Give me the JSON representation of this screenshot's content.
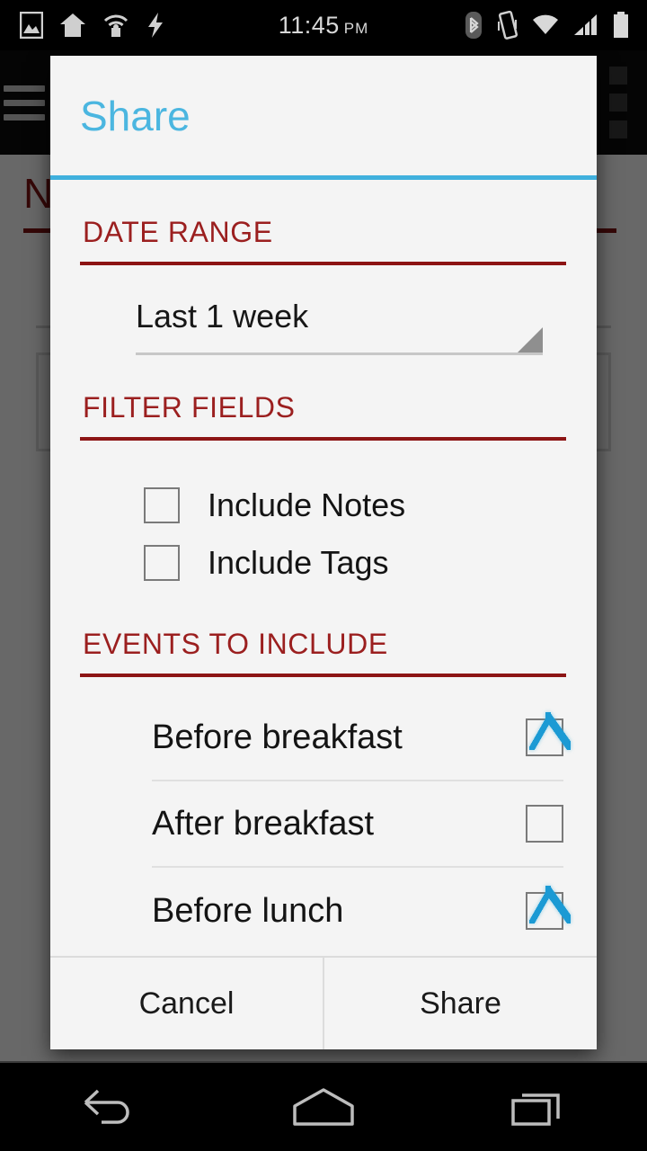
{
  "status_bar": {
    "time": "11:45",
    "ampm": "PM",
    "left_icons": [
      "photo-icon",
      "home-icon",
      "wifi-tether-icon",
      "usb-debug-icon"
    ],
    "right_icons": [
      "bluetooth-icon",
      "vibrate-icon",
      "wifi-icon",
      "signal-icon",
      "battery-icon"
    ]
  },
  "background_app": {
    "menu_icon": "hamburger-icon",
    "logo_icon": "app-logo-icon",
    "overflow_icon": "overflow-menu-icon",
    "page_title": "N"
  },
  "dialog": {
    "title": "Share",
    "accent_color": "#40b0dd",
    "section_color": "#9b1f1f",
    "sections": {
      "date_range": {
        "heading": "DATE RANGE",
        "spinner": {
          "name": "date-range-spinner",
          "value": "Last 1 week",
          "icon": "dropdown-triangle-icon"
        }
      },
      "filter_fields": {
        "heading": "FILTER FIELDS",
        "options": [
          {
            "label": "Include Notes",
            "checked": false
          },
          {
            "label": "Include Tags",
            "checked": false
          }
        ]
      },
      "events_to_include": {
        "heading": "EVENTS TO INCLUDE",
        "events": [
          {
            "label": "Before breakfast",
            "checked": true
          },
          {
            "label": "After breakfast",
            "checked": false
          },
          {
            "label": "Before lunch",
            "checked": true
          }
        ]
      }
    },
    "buttons": {
      "cancel": "Cancel",
      "share": "Share"
    }
  },
  "nav_bar": {
    "back": "back-icon",
    "home": "home-icon",
    "recents": "recent-apps-icon"
  }
}
